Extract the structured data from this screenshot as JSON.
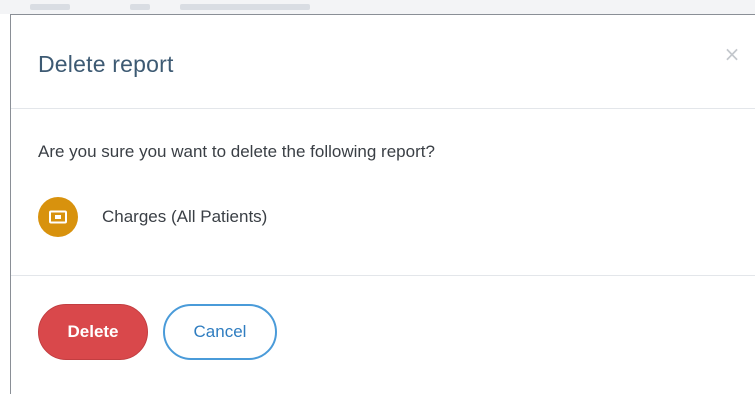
{
  "dialog": {
    "title": "Delete report",
    "close_symbol": "×",
    "prompt": "Are you sure you want to delete the following report?",
    "report": {
      "name": "Charges (All Patients)",
      "icon": "money-bill-icon",
      "icon_color": "#d8920d"
    },
    "buttons": {
      "delete_label": "Delete",
      "cancel_label": "Cancel"
    }
  },
  "colors": {
    "title": "#3d5a73",
    "delete_bg": "#d9484b",
    "cancel_border": "#4a9bd9"
  }
}
